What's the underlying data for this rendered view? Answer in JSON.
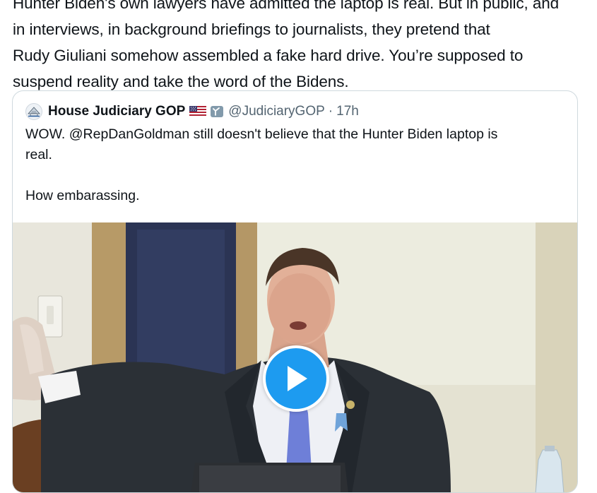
{
  "tweet": {
    "lines": [
      "Hunter Biden's own lawyers have admitted the laptop is real. But in public, and",
      "in interviews, in background briefings to journalists, they pretend that",
      "Rudy Giuliani somehow assembled a fake hard drive. You’re supposed to",
      "suspend reality and take the word of the Bidens."
    ]
  },
  "quote": {
    "name": "House Judiciary GOP",
    "handle": "@JudiciaryGOP",
    "separator": "·",
    "time": "17h",
    "text_line1": "WOW. @RepDanGoldman still doesn't believe that the Hunter Biden laptop is",
    "text_line2": "real.",
    "text_line3": "How embarassing."
  },
  "icons": {
    "avatar": "house-seal-icon",
    "flag": "us-flag-icon",
    "verified": "government-badge-icon",
    "play": "play-icon"
  },
  "colors": {
    "text": "#0f1419",
    "secondary": "#536471",
    "border": "#cfd9de",
    "accent": "#1d9bf0"
  }
}
